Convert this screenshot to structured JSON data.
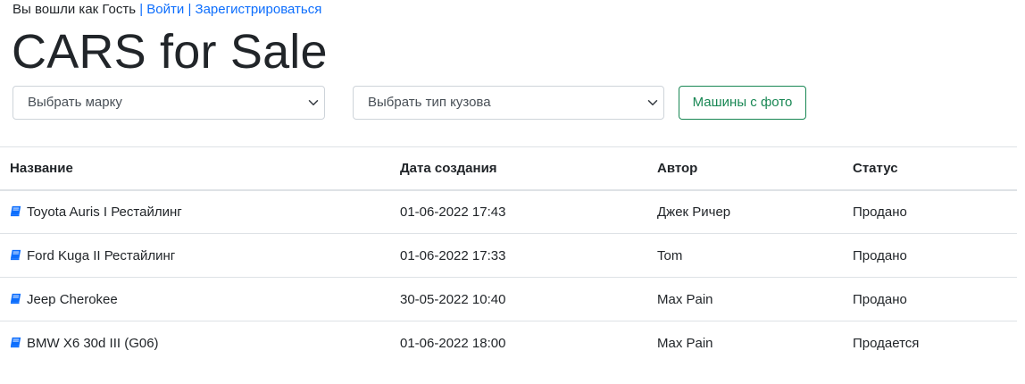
{
  "topbar": {
    "login_status": "Вы вошли как Гость",
    "separator": "|",
    "login_link": "Войти",
    "register_link": "Зарегистрироваться"
  },
  "page_title": "CARS for Sale",
  "filters": {
    "brand_select": "Выбрать марку",
    "body_type_select": "Выбрать тип кузова",
    "photo_button": "Машины с фото"
  },
  "colors": {
    "link": "#0d6efd",
    "success": "#198754",
    "icon": "#0d6efd"
  },
  "table": {
    "headers": [
      "Название",
      "Дата создания",
      "Автор",
      "Статус"
    ],
    "rows": [
      {
        "icon": "book-icon",
        "name": "Toyota Auris I Рестайлинг",
        "created": "01-06-2022 17:43",
        "author": "Джек Ричер",
        "status": "Продано"
      },
      {
        "icon": "book-icon",
        "name": "Ford Kuga II Рестайлинг",
        "created": "01-06-2022 17:33",
        "author": "Tom",
        "status": "Продано"
      },
      {
        "icon": "book-icon",
        "name": "Jeep Cherokee",
        "created": "30-05-2022 10:40",
        "author": "Max Pain",
        "status": "Продано"
      },
      {
        "icon": "book-icon",
        "name": "BMW X6 30d III (G06)",
        "created": "01-06-2022 18:00",
        "author": "Max Pain",
        "status": "Продается"
      }
    ]
  }
}
